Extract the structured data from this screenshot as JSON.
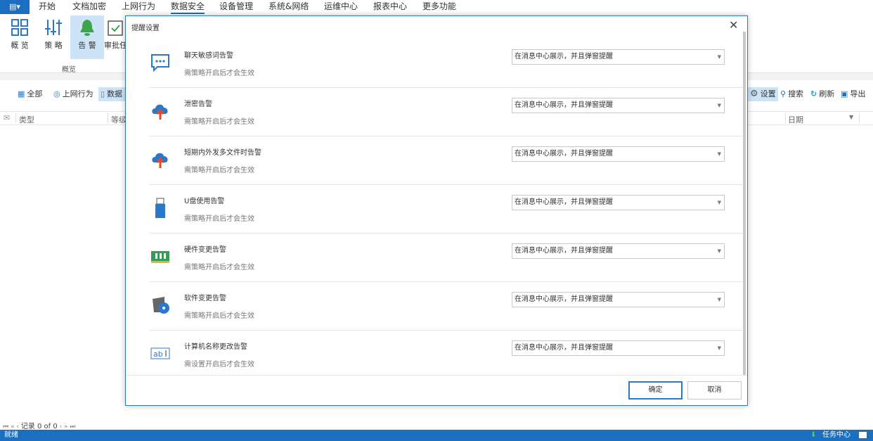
{
  "menubar": {
    "app_icon": "document-menu-icon",
    "items": [
      "开始",
      "文档加密",
      "上网行为",
      "数据安全",
      "设备管理",
      "系统&网络",
      "运维中心",
      "报表中心",
      "更多功能"
    ],
    "active": "数据安全"
  },
  "ribbon": {
    "buttons": [
      {
        "label": "概 览",
        "icon": "grid-icon"
      },
      {
        "label": "策 略",
        "icon": "sliders-icon"
      },
      {
        "label": "告 警",
        "icon": "bell-icon"
      },
      {
        "label": "审批任",
        "icon": "clipboard-check-icon"
      }
    ],
    "group_label": "概览"
  },
  "toolbar": {
    "left": [
      {
        "label": "全部",
        "icon": "calendar-icon"
      },
      {
        "label": "上网行为",
        "icon": "globe-search-icon"
      },
      {
        "label": "数据",
        "icon": "document-icon"
      }
    ],
    "right": [
      {
        "label": "设置",
        "icon": "gear-icon"
      },
      {
        "label": "搜索",
        "icon": "search-icon"
      },
      {
        "label": "刷新",
        "icon": "refresh-icon"
      },
      {
        "label": "导出",
        "icon": "export-icon"
      }
    ]
  },
  "columns": {
    "type": "类型",
    "level": "等级",
    "date": "日期"
  },
  "pager": {
    "text": "记录 0 of 0"
  },
  "status": {
    "left": "就绪",
    "task_center": "任务中心"
  },
  "dialog": {
    "title": "提醒设置",
    "ok": "确定",
    "cancel": "取消",
    "rows": [
      {
        "title": "聊天敏感词告警",
        "hint": "需策略开启后才会生效",
        "value": "在消息中心展示，并且弹窗提醒",
        "icon": "chat-icon"
      },
      {
        "title": "泄密告警",
        "hint": "需策略开启后才会生效",
        "value": "在消息中心展示，并且弹窗提醒",
        "icon": "cloud-upload-icon"
      },
      {
        "title": "短期内外发多文件时告警",
        "hint": "需策略开启后才会生效",
        "value": "在消息中心展示，并且弹窗提醒",
        "icon": "cloud-upload-icon"
      },
      {
        "title": "U盘使用告警",
        "hint": "需策略开启后才会生效",
        "value": "在消息中心展示，并且弹窗提醒",
        "icon": "usb-drive-icon"
      },
      {
        "title": "硬件变更告警",
        "hint": "需策略开启后才会生效",
        "value": "在消息中心展示，并且弹窗提醒",
        "icon": "memory-module-icon"
      },
      {
        "title": "软件变更告警",
        "hint": "需策略开启后才会生效",
        "value": "在消息中心展示，并且弹窗提醒",
        "icon": "software-disc-icon"
      },
      {
        "title": "计算机名称更改告警",
        "hint": "需设置开启后才会生效",
        "value": "在消息中心展示，并且弹窗提醒",
        "icon": "rename-icon"
      }
    ]
  }
}
